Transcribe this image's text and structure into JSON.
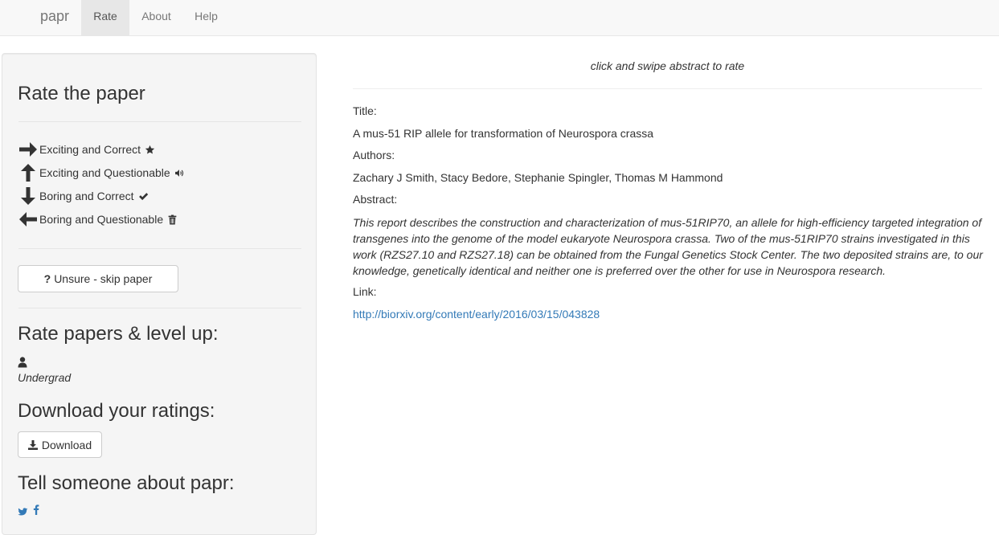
{
  "navbar": {
    "brand": "papr",
    "items": [
      {
        "label": "Rate",
        "active": true
      },
      {
        "label": "About",
        "active": false
      },
      {
        "label": "Help",
        "active": false
      }
    ]
  },
  "sidebar": {
    "rate_heading": "Rate the paper",
    "rate_options": [
      {
        "direction": "right",
        "label": "Exciting and Correct",
        "icon": "star-icon"
      },
      {
        "direction": "up",
        "label": "Exciting and Questionable",
        "icon": "volume-icon"
      },
      {
        "direction": "down",
        "label": "Boring and Correct",
        "icon": "check-icon"
      },
      {
        "direction": "left",
        "label": "Boring and Questionable",
        "icon": "trash-icon"
      }
    ],
    "skip_button": {
      "prefix": "?",
      "label": "Unsure - skip paper"
    },
    "level_heading": "Rate papers & level up:",
    "level": "Undergrad",
    "download_heading": "Download your ratings:",
    "download_button": "Download",
    "share_heading": "Tell someone about papr:",
    "share_icons": [
      "twitter-icon",
      "facebook-icon"
    ]
  },
  "main": {
    "instruction": "click and swipe abstract to rate",
    "title_label": "Title:",
    "title": "A mus-51 RIP allele for transformation of Neurospora crassa",
    "authors_label": "Authors:",
    "authors": "Zachary J Smith, Stacy Bedore, Stephanie Spingler, Thomas M Hammond",
    "abstract_label": "Abstract:",
    "abstract": "This report describes the construction and characterization of mus-51RIP70, an allele for high-efficiency targeted integration of transgenes into the genome of the model eukaryote Neurospora crassa. Two of the mus-51RIP70 strains investigated in this work (RZS27.10 and RZS27.18) can be obtained from the Fungal Genetics Stock Center. The two deposited strains are, to our knowledge, genetically identical and neither one is preferred over the other for use in Neurospora research.",
    "link_label": "Link:",
    "link": "http://biorxiv.org/content/early/2016/03/15/043828"
  },
  "colors": {
    "link": "#337ab7",
    "navbar_bg": "#f8f8f8",
    "sidebar_bg": "#f5f5f5",
    "text": "#333333"
  }
}
